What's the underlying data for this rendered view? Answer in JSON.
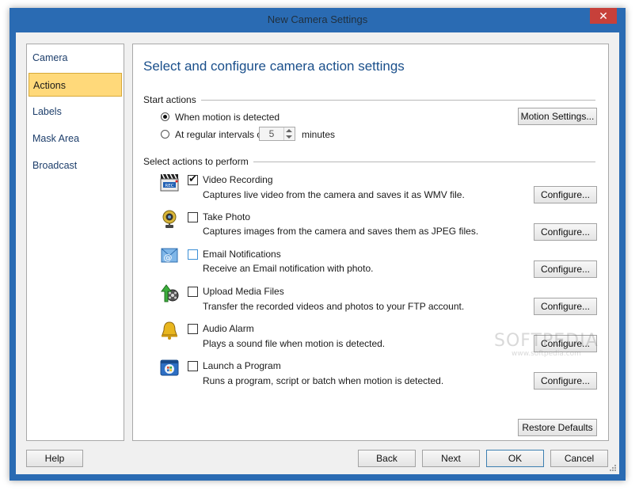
{
  "window": {
    "title": "New Camera Settings"
  },
  "nav": {
    "items": [
      {
        "label": "Camera",
        "selected": false
      },
      {
        "label": "Actions",
        "selected": true
      },
      {
        "label": "Labels",
        "selected": false
      },
      {
        "label": "Mask Area",
        "selected": false
      },
      {
        "label": "Broadcast",
        "selected": false
      }
    ]
  },
  "page": {
    "heading": "Select and configure camera action settings",
    "start_actions": {
      "label": "Start actions",
      "option_motion": "When motion is detected",
      "option_interval": "At regular intervals of",
      "interval_value": "5",
      "interval_unit": "minutes",
      "selected": "motion",
      "motion_settings_button": "Motion Settings..."
    },
    "select_actions_label": "Select actions to perform",
    "actions": [
      {
        "title": "Video Recording",
        "desc": "Captures live video from the camera and saves it as WMV file.",
        "checked": true,
        "icon": "video-recording-icon",
        "configure": "Configure..."
      },
      {
        "title": "Take Photo",
        "desc": "Captures images from the camera and saves them as JPEG files.",
        "checked": false,
        "icon": "webcam-icon",
        "configure": "Configure..."
      },
      {
        "title": "Email Notifications",
        "desc": "Receive an Email notification with photo.",
        "checked": false,
        "icon": "email-icon",
        "configure": "Configure..."
      },
      {
        "title": "Upload Media Files",
        "desc": "Transfer the recorded videos and photos to your FTP account.",
        "checked": false,
        "icon": "upload-icon",
        "configure": "Configure..."
      },
      {
        "title": "Audio Alarm",
        "desc": "Plays a sound file when motion is detected.",
        "checked": false,
        "icon": "bell-icon",
        "configure": "Configure..."
      },
      {
        "title": "Launch a Program",
        "desc": "Runs a program, script or batch when motion is detected.",
        "checked": false,
        "icon": "program-icon",
        "configure": "Configure..."
      }
    ],
    "restore_defaults": "Restore Defaults"
  },
  "footer": {
    "help": "Help",
    "back": "Back",
    "next": "Next",
    "ok": "OK",
    "cancel": "Cancel"
  },
  "watermark": {
    "text": "SOFTPEDIA",
    "sub": "www.softpedia.com"
  }
}
